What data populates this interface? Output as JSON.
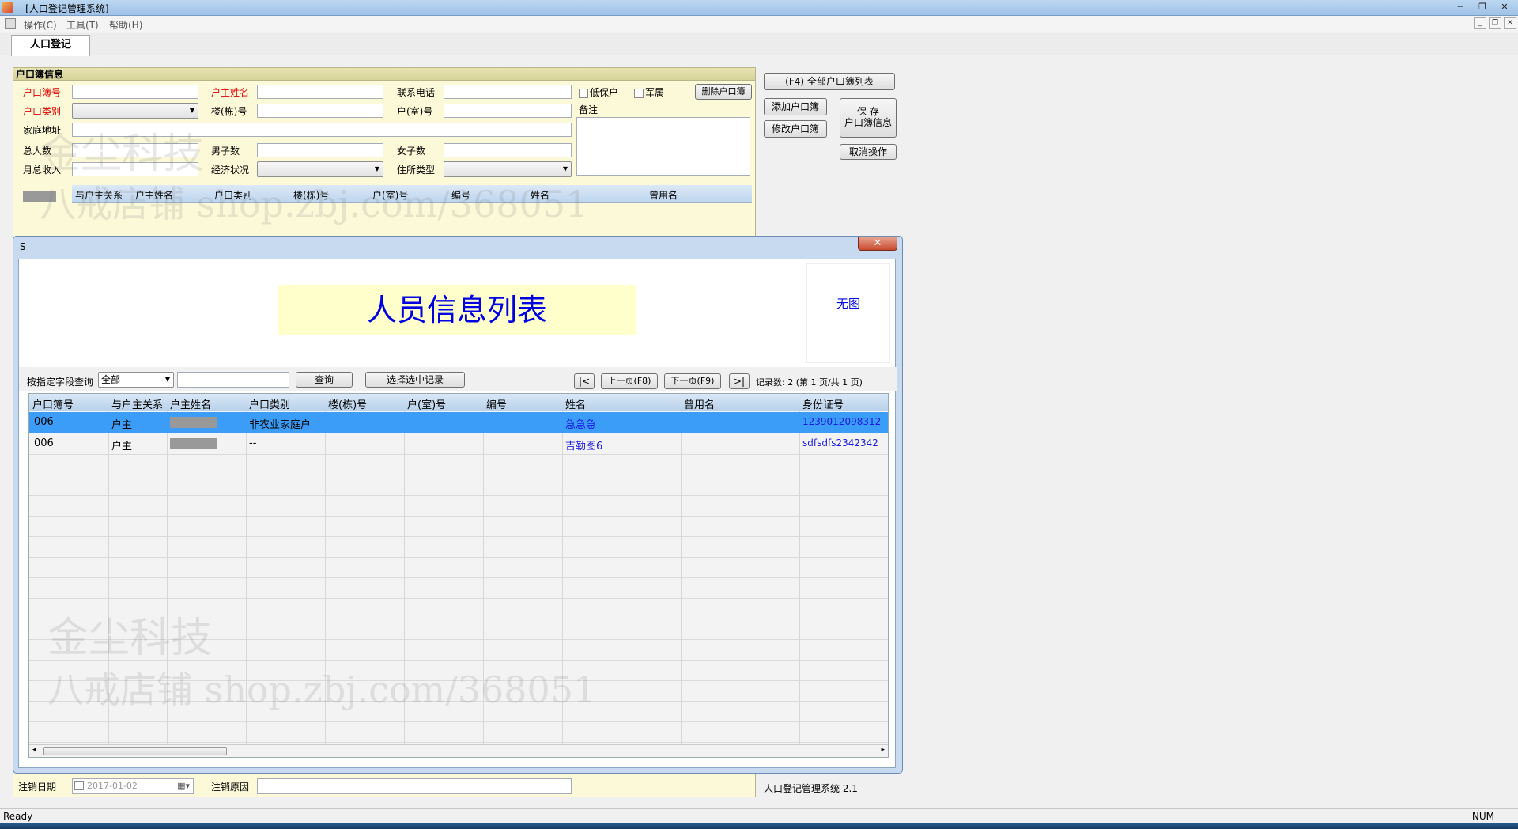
{
  "window": {
    "title": "- [人口登记管理系统]"
  },
  "menu": [
    "操作(C)",
    "工具(T)",
    "帮助(H)"
  ],
  "tab": {
    "label": "人口登记"
  },
  "household": {
    "title": "户口簿信息",
    "labels": {
      "book_no": "户口簿号",
      "head_name": "户主姓名",
      "phone": "联系电话",
      "book_type": "户口类别",
      "building": "楼(栋)号",
      "room": "户(室)号",
      "address": "家庭地址",
      "total": "总人数",
      "male": "男子数",
      "female": "女子数",
      "income": "月总收入",
      "economy": "经济状况",
      "residence": "住所类型",
      "low_income": "低保户",
      "military": "军属",
      "note": "备注"
    },
    "delete_button": "删除户口簿",
    "grid_headers": [
      "与户主关系",
      "户主姓名",
      "户口类别",
      "楼(栋)号",
      "户(室)号",
      "编号",
      "姓名",
      "曾用名"
    ]
  },
  "actions": {
    "all_list": "(F4) 全部户口簿列表",
    "add": "添加户口簿",
    "edit": "修改户口簿",
    "save_line1": "保 存",
    "save_line2": "户口簿信息",
    "cancel": "取消操作"
  },
  "dialog": {
    "caption": "S",
    "close": "✕",
    "banner": "人员信息列表",
    "no_image": "无图",
    "query_label": "按指定字段查询",
    "field_select": "全部",
    "search_value": "",
    "query_button": "查询",
    "select_button": "选择选中记录",
    "first": "|<",
    "prev": "上一页(F8)",
    "next": "下一页(F9)",
    "last": ">|",
    "record_count": "记录数: 2 (第 1 页/共 1 页)",
    "columns": [
      "户口簿号",
      "与户主关系",
      "户主姓名",
      "户口类别",
      "楼(栋)号",
      "户(室)号",
      "编号",
      "姓名",
      "曾用名",
      "身份证号"
    ],
    "rows": [
      [
        "006",
        "户主",
        "",
        "非农业家庭户",
        "",
        "",
        "",
        "急急急",
        "",
        "1239012098312"
      ],
      [
        "006",
        "户主",
        "",
        "--",
        "",
        "",
        "",
        "吉勒图6",
        "",
        "sdfsdfs2342342"
      ]
    ]
  },
  "cancel_bar": {
    "date_label": "注销日期",
    "date_value": "2017-01-02",
    "reason_label": "注销原因",
    "version": "人口登记管理系统 2.1"
  },
  "status": {
    "left": "Ready",
    "right": "NUM"
  },
  "watermark": {
    "line1": "金尘科技",
    "line2": "八戒店铺 shop.zbj.com/368051"
  },
  "colors": {
    "selection": "#3c9df8",
    "banner_bg": "#ffffcc",
    "panel_bg": "#fcf9d8",
    "required_label": "#e00000"
  }
}
